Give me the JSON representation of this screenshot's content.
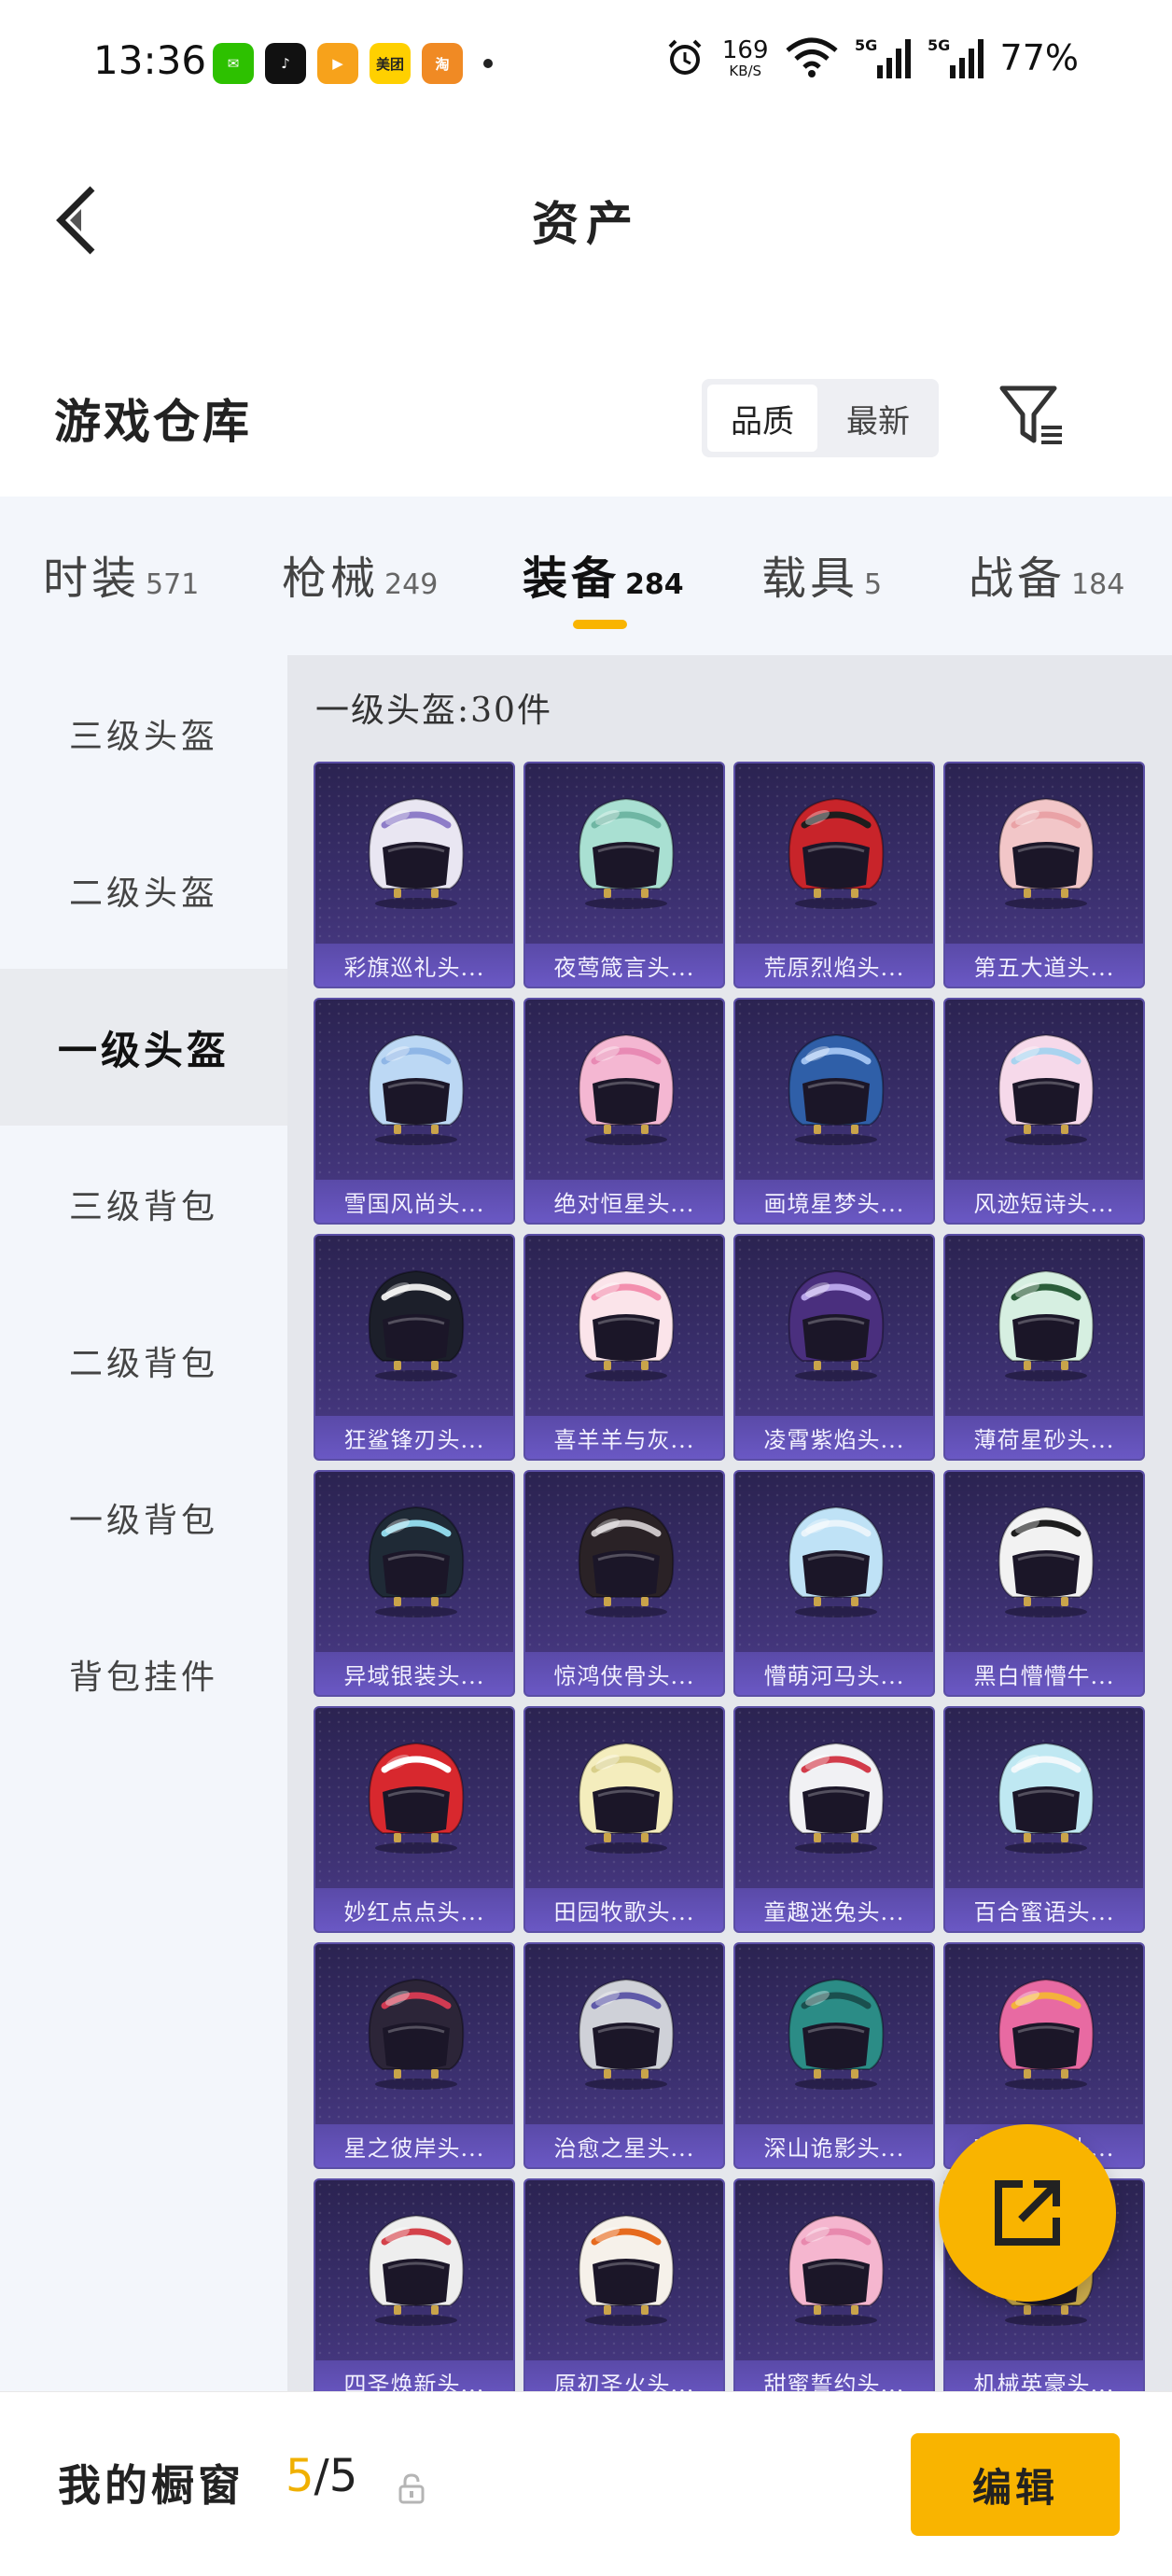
{
  "status": {
    "time": "13:36",
    "apps": [
      {
        "icon": "wechat-icon",
        "color": "#2dc100",
        "glyph": "✉"
      },
      {
        "icon": "tiktok-icon",
        "color": "#111111",
        "glyph": "♪"
      },
      {
        "icon": "video-app-icon",
        "color": "#f7a21b",
        "glyph": "▶"
      },
      {
        "icon": "meituan-icon",
        "color": "#ffd000",
        "glyph": "美团"
      },
      {
        "icon": "taobao-special-icon",
        "color": "#f08a24",
        "glyph": "淘"
      }
    ],
    "speed_value": "169",
    "speed_unit": "KB/S",
    "network": "5G",
    "battery": "77%"
  },
  "header": {
    "title": "资产"
  },
  "section": {
    "title": "游戏仓库",
    "sort_options": [
      "品质",
      "最新"
    ],
    "sort_active": 0
  },
  "categories": [
    {
      "label": "时装",
      "count": "571"
    },
    {
      "label": "枪械",
      "count": "249"
    },
    {
      "label": "装备",
      "count": "284",
      "active": true
    },
    {
      "label": "载具",
      "count": "5"
    },
    {
      "label": "战备",
      "count": "184"
    }
  ],
  "sidebar": {
    "items": [
      "三级头盔",
      "二级头盔",
      "一级头盔",
      "三级背包",
      "二级背包",
      "一级背包",
      "背包挂件"
    ],
    "active_index": 2
  },
  "content": {
    "subtitle": "一级头盔:30件",
    "items": [
      {
        "name": "彩旗巡礼头...",
        "color": "#e9e6f2",
        "accent": "#8e7dc8"
      },
      {
        "name": "夜莺箴言头...",
        "color": "#a9e0d2",
        "accent": "#6fb6a3"
      },
      {
        "name": "荒原烈焰头...",
        "color": "#c8242a",
        "accent": "#1d1d1d"
      },
      {
        "name": "第五大道头...",
        "color": "#f2c6c8",
        "accent": "#e9a2a6"
      },
      {
        "name": "雪国风尚头...",
        "color": "#bcd8f4",
        "accent": "#8fb6e6"
      },
      {
        "name": "绝对恒星头...",
        "color": "#f4b7d2",
        "accent": "#e88ab4"
      },
      {
        "name": "画境星梦头...",
        "color": "#2f5fa8",
        "accent": "#9fc1f0"
      },
      {
        "name": "风迹短诗头...",
        "color": "#f6d9ea",
        "accent": "#a9d3ef"
      },
      {
        "name": "狂鲨锋刃头...",
        "color": "#1c1f2a",
        "accent": "#e6e6e6"
      },
      {
        "name": "喜羊羊与灰...",
        "color": "#fbe4ea",
        "accent": "#f38fae"
      },
      {
        "name": "凌霄紫焰头...",
        "color": "#4a2f7e",
        "accent": "#b7a3e8"
      },
      {
        "name": "薄荷星砂头...",
        "color": "#d6efe1",
        "accent": "#2b5e3a"
      },
      {
        "name": "异域银装头...",
        "color": "#1f2a36",
        "accent": "#8fd6e8"
      },
      {
        "name": "惊鸿侠骨头...",
        "color": "#2a2226",
        "accent": "#c9c3c6"
      },
      {
        "name": "懵萌河马头...",
        "color": "#bfe2f6",
        "accent": "#e9f4fb"
      },
      {
        "name": "黑白懵懵牛...",
        "color": "#f2f2f2",
        "accent": "#1e1e1e"
      },
      {
        "name": "妙红点点头...",
        "color": "#d8282e",
        "accent": "#ffffff"
      },
      {
        "name": "田园牧歌头...",
        "color": "#f4edbd",
        "accent": "#d9cf8a"
      },
      {
        "name": "童趣迷兔头...",
        "color": "#f1f1f4",
        "accent": "#d23b4a"
      },
      {
        "name": "百合蜜语头...",
        "color": "#bfe8f2",
        "accent": "#f2f8fb"
      },
      {
        "name": "星之彼岸头...",
        "color": "#2c2538",
        "accent": "#d03a52"
      },
      {
        "name": "治愈之星头...",
        "color": "#cfd1d8",
        "accent": "#5f5aa8"
      },
      {
        "name": "深山诡影头...",
        "color": "#2b8c86",
        "accent": "#1a4f4e"
      },
      {
        "name": "花间玉兔头...",
        "color": "#e86aa2",
        "accent": "#f4b13c"
      },
      {
        "name": "四圣焕新头...",
        "color": "#eeeeee",
        "accent": "#d4424a"
      },
      {
        "name": "原初圣火头...",
        "color": "#f6f1ea",
        "accent": "#e66a1e"
      },
      {
        "name": "甜蜜誓约头...",
        "color": "#f5b6cf",
        "accent": "#e889ae"
      },
      {
        "name": "机械英豪头...",
        "color": "#c8a84a",
        "accent": "#7a6a3a"
      }
    ]
  },
  "bottom": {
    "showcase_label": "我的橱窗",
    "showcase_current": "5",
    "showcase_total": "/5",
    "edit_label": "编辑"
  },
  "colors": {
    "accent": "#f9b400",
    "card_bg": "#3a2f6d",
    "sidebar_bg": "#f3f6fb"
  }
}
